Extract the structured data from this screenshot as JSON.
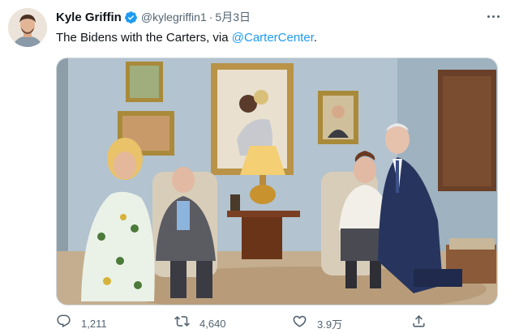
{
  "tweet": {
    "author_name": "Kyle Griffin",
    "handle": "@kylegriffin1",
    "separator": "·",
    "date": "5月3日",
    "text_before_link": "The Bidens with the Carters, via ",
    "link_text": "@CarterCenter",
    "text_after_link": ".",
    "verified": true
  },
  "actions": {
    "reply_count": "1,211",
    "retweet_count": "4,640",
    "like_count": "3.9万"
  },
  "icons": {
    "more": "more-dots-icon",
    "verified": "verified-badge-icon",
    "reply": "reply-icon",
    "retweet": "retweet-icon",
    "like": "heart-icon",
    "share": "share-icon"
  },
  "colors": {
    "accent": "#1d9bf0",
    "text": "#0f1419",
    "secondary": "#536471",
    "border": "#cfd9de"
  }
}
